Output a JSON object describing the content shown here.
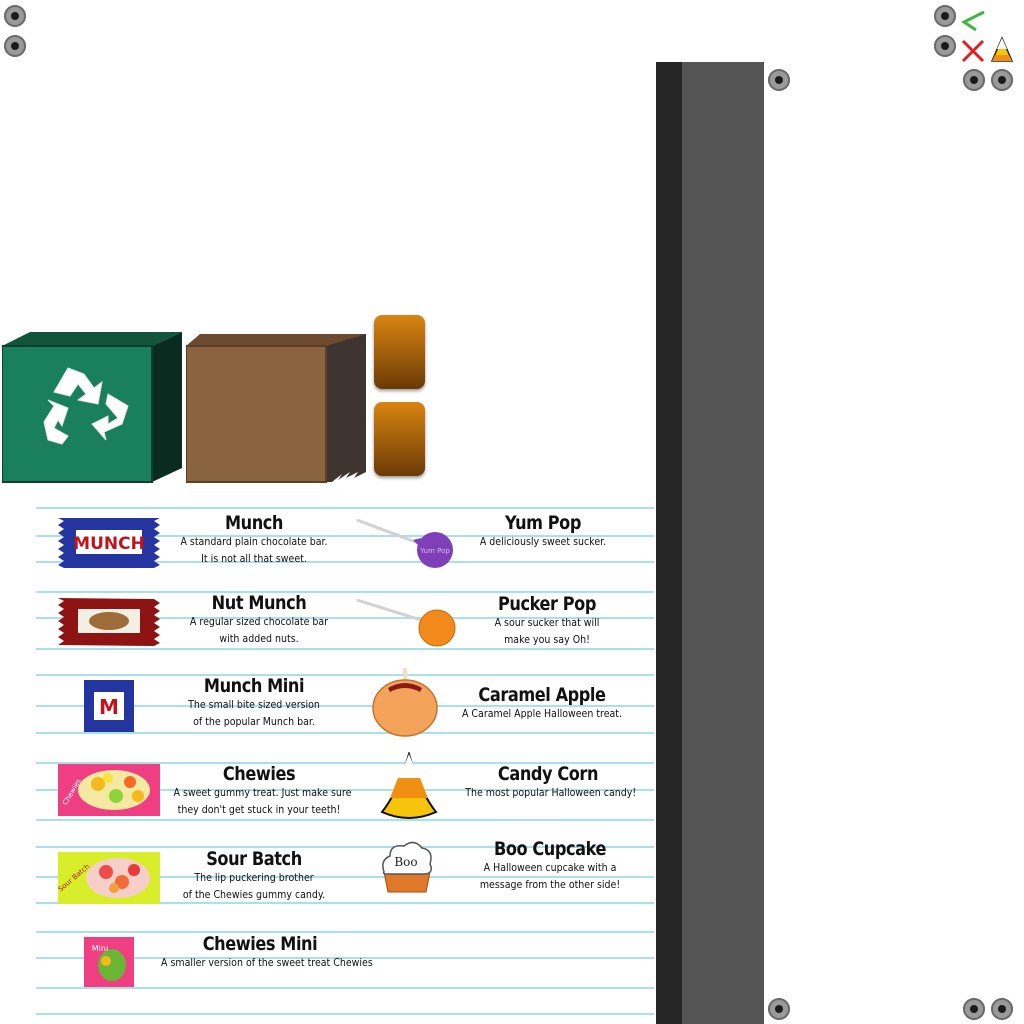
{
  "toolbar": {
    "back_icon": "green-checkmark-back-icon",
    "close_icon": "red-x-close-icon",
    "candy_corn_icon": "candy-corn-icon",
    "back_color": "#3fb53f",
    "close_color": "#e02020"
  },
  "scene": {
    "recycle_bin_color": "#197f5c",
    "bag_color": "#8a6341",
    "caramel_button_color": "#b2630a"
  },
  "candies": [
    {
      "name": "Munch",
      "desc1": "A standard plain chocolate bar.",
      "desc2": "It is not all that sweet.",
      "wrapper_text": "MUNCH"
    },
    {
      "name": "Nut Munch",
      "desc1": "A regular sized chocolate bar",
      "desc2": "with added nuts."
    },
    {
      "name": "Munch Mini",
      "desc1": "The small bite sized version",
      "desc2": "of the popular Munch bar.",
      "wrapper_text": "M"
    },
    {
      "name": "Chewies",
      "desc1": "A sweet gummy treat. Just make sure",
      "desc2": "they don't get stuck in your teeth!",
      "wrapper_text": "Chewies"
    },
    {
      "name": "Sour Batch",
      "desc1": "The lip puckering brother",
      "desc2": "of the Chewies gummy candy.",
      "wrapper_text": "Sour Batch"
    },
    {
      "name": "Chewies Mini",
      "desc1": "A smaller version of the sweet treat Chewies",
      "desc2": "",
      "wrapper_text": "Mini"
    },
    {
      "name": "Yum Pop",
      "desc1": "A deliciously sweet sucker.",
      "desc2": "",
      "wrapper_text": "Yum Pop"
    },
    {
      "name": "Pucker Pop",
      "desc1": "A sour sucker that will",
      "desc2": "make you say Oh!"
    },
    {
      "name": "Caramel Apple",
      "desc1": "A Caramel Apple Halloween treat.",
      "desc2": ""
    },
    {
      "name": "Candy Corn",
      "desc1": "The most popular Halloween candy!",
      "desc2": ""
    },
    {
      "name": "Boo Cupcake",
      "desc1": "A Halloween cupcake with a",
      "desc2": "message from the other side!",
      "wrapper_text": "Boo"
    }
  ]
}
